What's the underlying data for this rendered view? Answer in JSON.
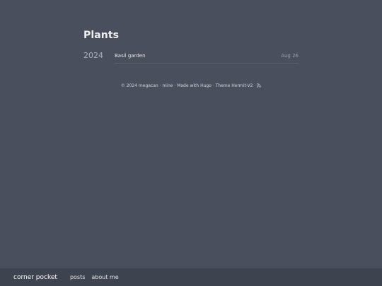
{
  "page": {
    "title": "Plants"
  },
  "posts_by_year": [
    {
      "year": "2024",
      "posts": [
        {
          "title": "Basil garden",
          "date": "Aug 26"
        }
      ]
    }
  ],
  "footer": {
    "copyright": "© 2024 megacan",
    "sep1": " · ",
    "link1": "mine",
    "sep2": " · ",
    "made_with": "Made with Hugo",
    "sep3": " · ",
    "theme": "Theme Hermit-V2",
    "sep4": " · ",
    "rss_icon": "rss-icon"
  },
  "bottom_bar": {
    "site_title": "corner pocket",
    "nav": [
      "posts",
      "about me"
    ]
  },
  "colors": {
    "background": "#494f5c",
    "bar": "#3e4350",
    "text": "#dadadb"
  }
}
